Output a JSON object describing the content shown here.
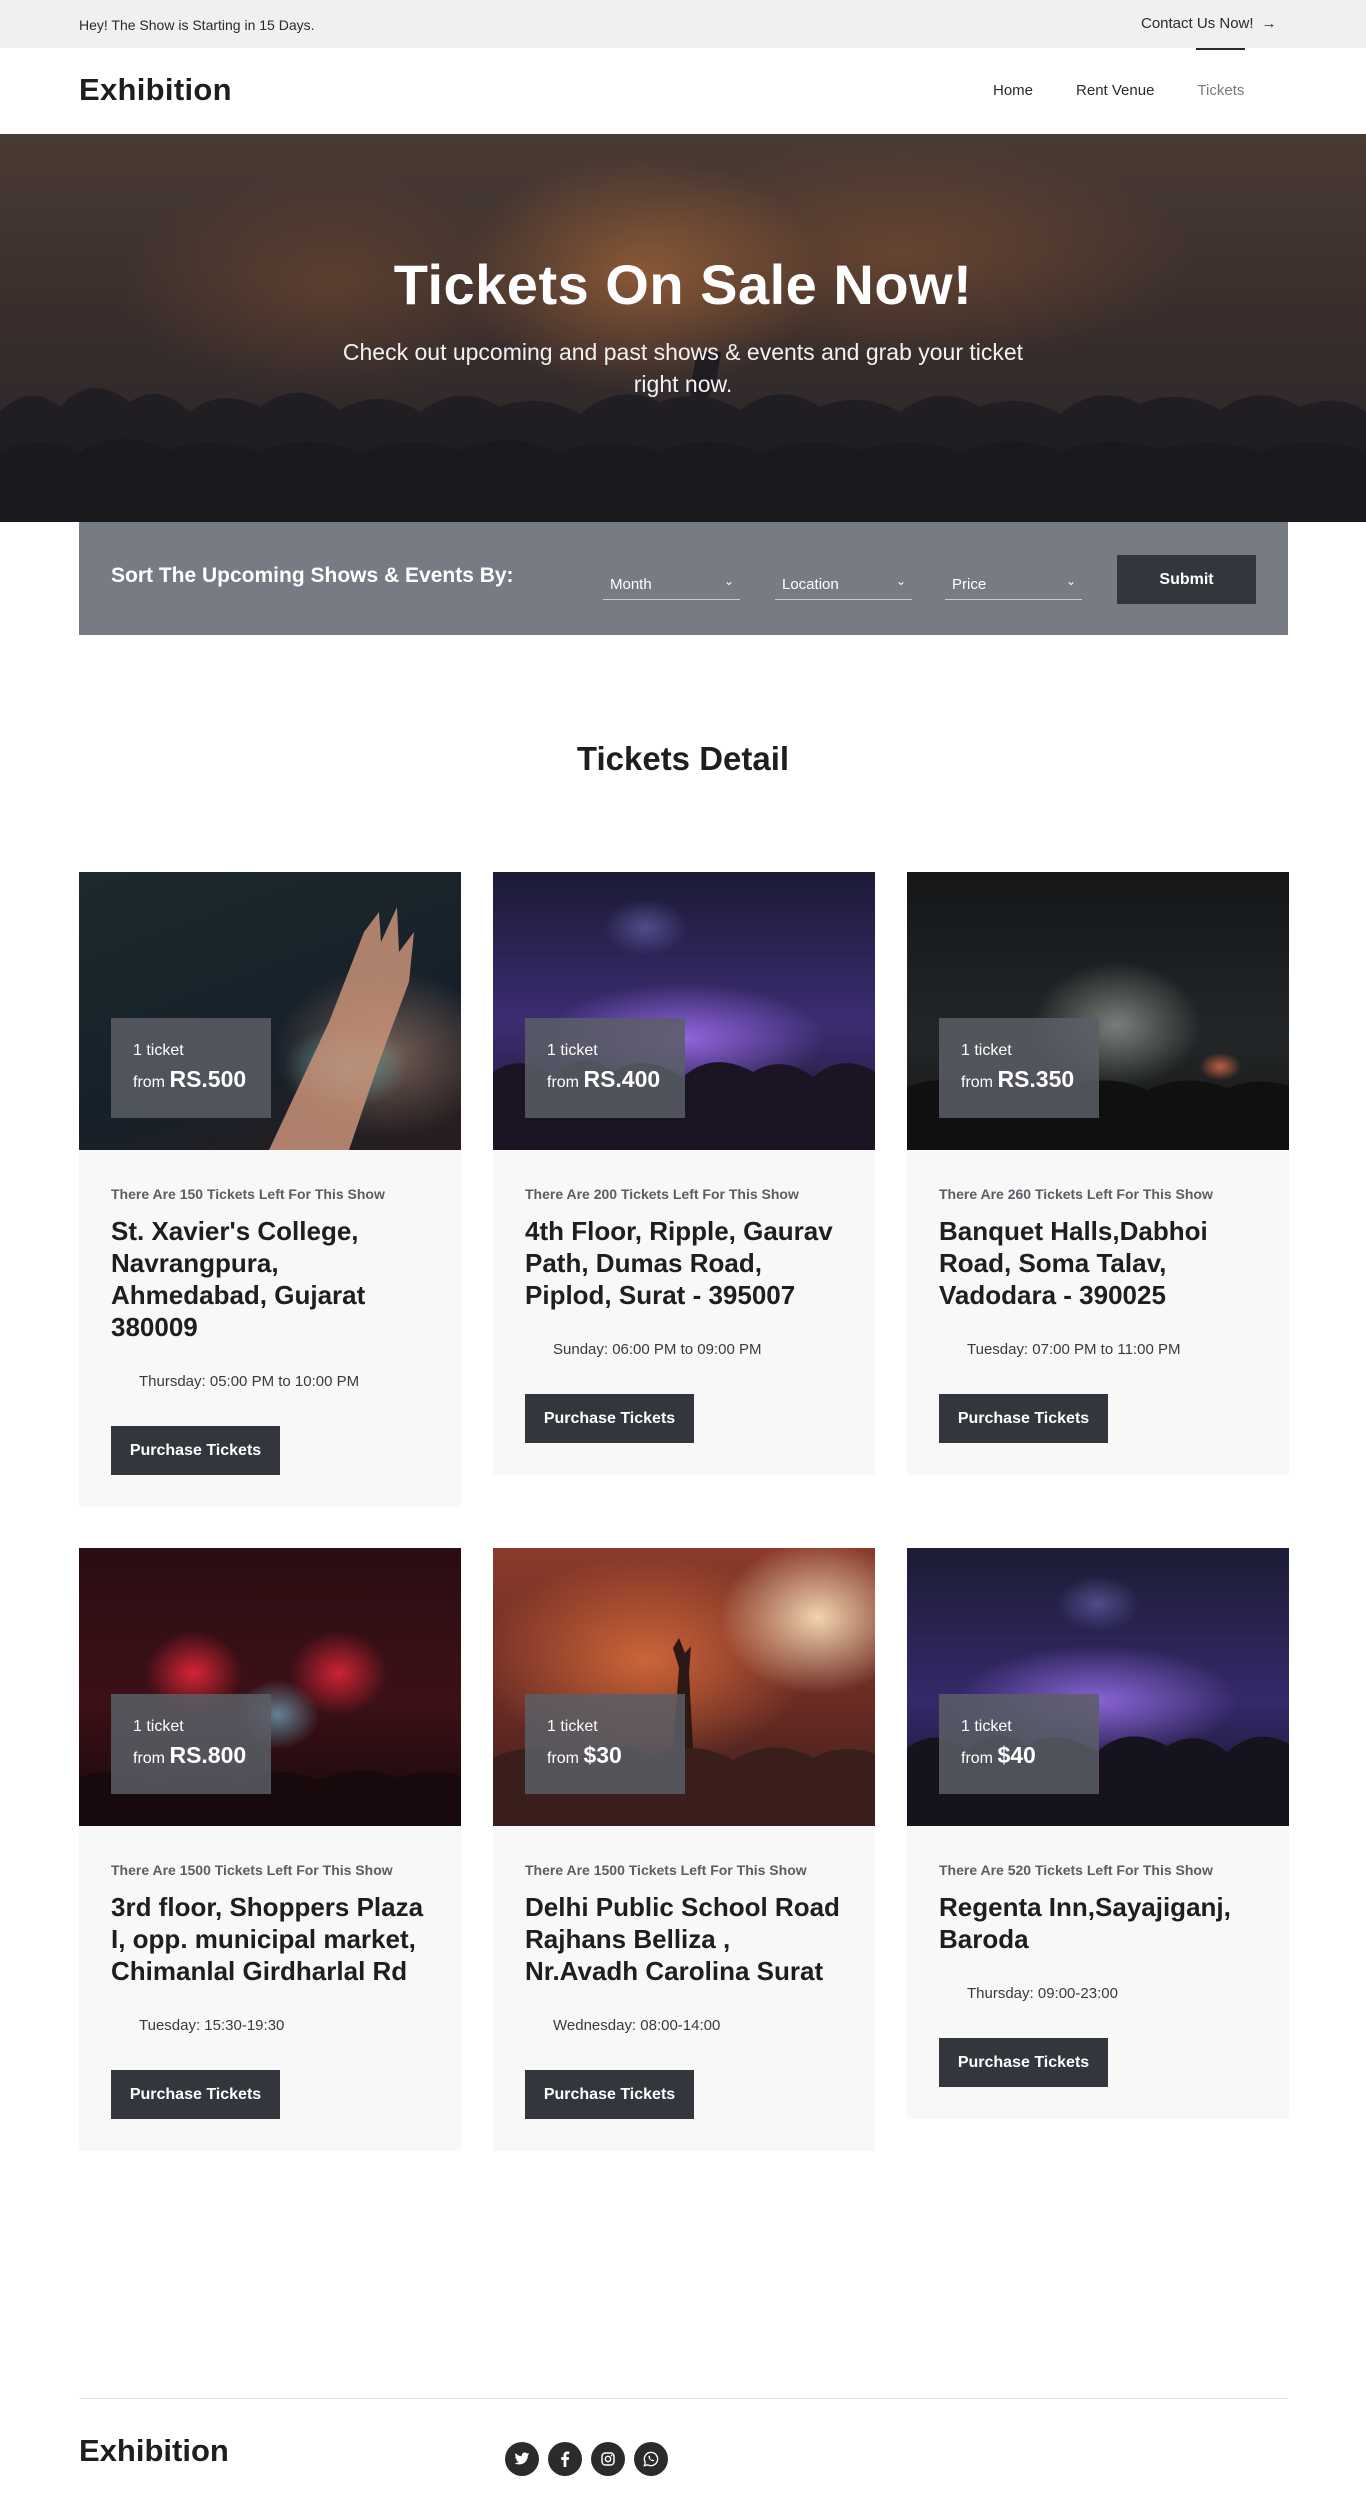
{
  "topbar": {
    "note": "Hey! The Show is Starting in 15 Days.",
    "contact_label": "Contact Us Now!",
    "contact_icon": "arrow-right-icon"
  },
  "header": {
    "logo": "Exhibition",
    "nav": [
      "Home",
      "Rent Venue",
      "Tickets"
    ],
    "active_nav": "Tickets"
  },
  "hero": {
    "title": "Tickets On Sale Now!",
    "subtitle": "Check out upcoming and past shows & events and grab your ticket right now."
  },
  "sort": {
    "label": "Sort The Upcoming Shows & Events By:",
    "month": "Month",
    "location": "Location",
    "price": "Price",
    "submit": "Submit"
  },
  "section": {
    "title": "Tickets Detail"
  },
  "cards": [
    {
      "qty": "1 ticket",
      "from": "from",
      "amount": "RS.500",
      "tickets_left": "There Are 150 Tickets Left For This Show",
      "venue": "St. Xavier's College, Navrangpura, Ahmedabad, Gujarat 380009",
      "time": "Thursday: 05:00 PM to 10:00 PM",
      "button": "Purchase Tickets"
    },
    {
      "qty": "1 ticket",
      "from": "from",
      "amount": "RS.400",
      "tickets_left": "There Are 200 Tickets Left For This Show",
      "venue": "4th Floor, Ripple, Gaurav Path, Dumas Road, Piplod, Surat - 395007",
      "time": "Sunday: 06:00 PM to 09:00 PM",
      "button": "Purchase Tickets"
    },
    {
      "qty": "1 ticket",
      "from": "from",
      "amount": "RS.350",
      "tickets_left": "There Are 260 Tickets Left For This Show",
      "venue": "Banquet Halls,Dabhoi Road, Soma Talav, Vadodara - 390025",
      "time": "Tuesday: 07:00 PM to 11:00 PM",
      "button": "Purchase Tickets"
    },
    {
      "qty": "1 ticket",
      "from": "from",
      "amount": "RS.800",
      "tickets_left": "There Are 1500 Tickets Left For This Show",
      "venue": "3rd floor, Shoppers Plaza I, opp. municipal market, Chimanlal Girdharlal Rd",
      "time": "Tuesday: 15:30-19:30",
      "button": "Purchase Tickets"
    },
    {
      "qty": "1 ticket",
      "from": "from",
      "amount": "$30",
      "tickets_left": "There Are 1500 Tickets Left For This Show",
      "venue": "Delhi Public School Road Rajhans Belliza , Nr.Avadh Carolina Surat",
      "time": "Wednesday: 08:00-14:00",
      "button": "Purchase Tickets"
    },
    {
      "qty": "1 ticket",
      "from": "from",
      "amount": "$40",
      "tickets_left": "There Are 520 Tickets Left For This Show",
      "venue": "Regenta Inn,Sayajiganj, Baroda",
      "time": "Thursday: 09:00-23:00",
      "button": "Purchase Tickets"
    }
  ],
  "footer": {
    "logo": "Exhibition",
    "social_icons": [
      "twitter-icon",
      "facebook-icon",
      "instagram-icon",
      "whatsapp-icon"
    ]
  },
  "colors": {
    "topbar_bg": "#f0f0f0",
    "sortbar_bg": "#777b83",
    "button_bg": "#33363c",
    "card_bg": "#f8f8f8"
  }
}
